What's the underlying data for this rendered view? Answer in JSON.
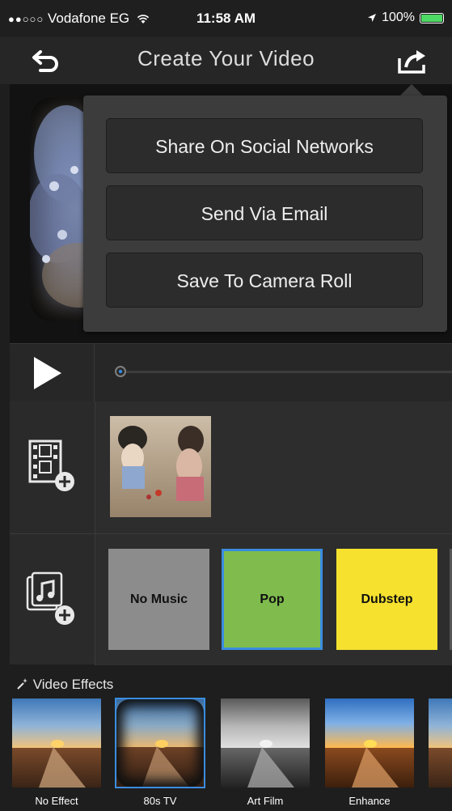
{
  "status_bar": {
    "signal": "●●○○○",
    "carrier": "Vodafone EG",
    "wifi_icon": "wifi-icon",
    "time": "11:58 AM",
    "location_icon": "location-arrow-icon",
    "battery_percent": "100%",
    "battery_level": 1.0
  },
  "nav": {
    "title": "Create Your Video",
    "back_icon": "undo-arrow-icon",
    "share_icon": "share-icon"
  },
  "share_menu": {
    "items": [
      "Share On Social Networks",
      "Send Via Email",
      "Save To Camera Roll"
    ]
  },
  "player": {
    "play_icon": "play-icon",
    "progress": 0.0,
    "accent": "#2f8ff0"
  },
  "sidebar": {
    "add_clip_icon": "add-film-icon",
    "add_music_icon": "add-music-icon"
  },
  "music": {
    "options": [
      {
        "label": "No Music",
        "color": "#8c8c8c",
        "selected": false
      },
      {
        "label": "Pop",
        "color": "#7fbc4d",
        "selected": true
      },
      {
        "label": "Dubstep",
        "color": "#f5e12e",
        "selected": false
      }
    ],
    "selected_border": "#3a8de0"
  },
  "effects": {
    "header": "Video Effects",
    "header_icon": "magic-wand-icon",
    "items": [
      {
        "label": "No Effect",
        "selected": false
      },
      {
        "label": "80s TV",
        "selected": true
      },
      {
        "label": "Art Film",
        "selected": false
      },
      {
        "label": "Enhance",
        "selected": false
      }
    ]
  }
}
